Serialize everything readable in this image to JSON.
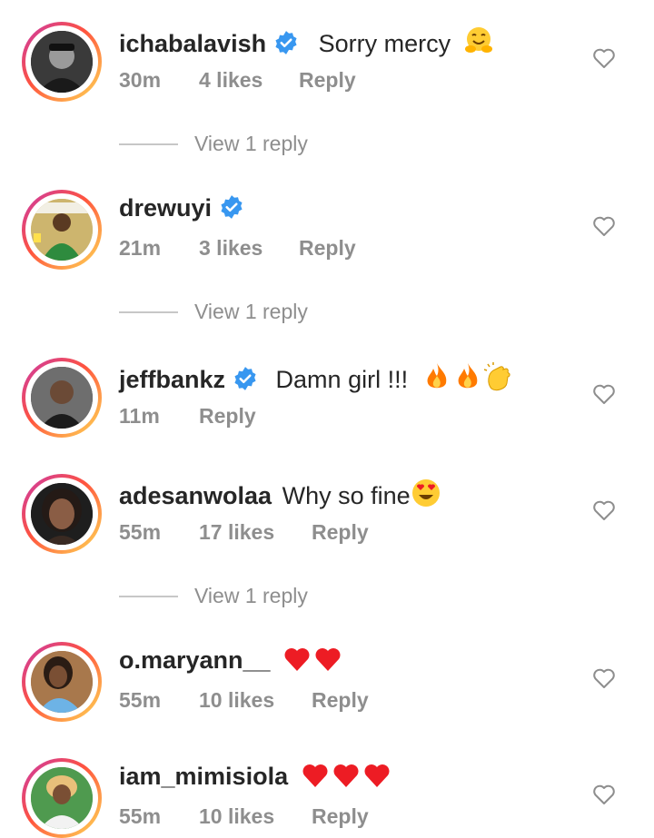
{
  "comments": [
    {
      "username": "ichabalavish",
      "verified": true,
      "text": "Sorry mercy",
      "emojis": [
        "hug"
      ],
      "time": "30m",
      "likes": "4 likes",
      "reply": "Reply",
      "view_replies": "View 1 reply"
    },
    {
      "username": "drewuyi",
      "verified": true,
      "text": "",
      "emojis": [],
      "time": "21m",
      "likes": "3 likes",
      "reply": "Reply",
      "view_replies": "View 1 reply"
    },
    {
      "username": "jeffbankz",
      "verified": true,
      "text": "Damn girl !!!",
      "emojis": [
        "fire",
        "fire",
        "clap"
      ],
      "time": "11m",
      "likes": "",
      "reply": "Reply",
      "view_replies": ""
    },
    {
      "username": "adesanwolaa",
      "verified": false,
      "text": "Why so fine",
      "emojis": [
        "heart-eyes"
      ],
      "time": "55m",
      "likes": "17 likes",
      "reply": "Reply",
      "view_replies": "View 1 reply"
    },
    {
      "username": "o.maryann__",
      "verified": false,
      "text": "",
      "emojis": [
        "red-heart",
        "red-heart"
      ],
      "time": "55m",
      "likes": "10 likes",
      "reply": "Reply",
      "view_replies": ""
    },
    {
      "username": "iam_mimisiola",
      "verified": false,
      "text": "",
      "emojis": [
        "red-heart",
        "red-heart",
        "red-heart"
      ],
      "time": "55m",
      "likes": "10 likes",
      "reply": "Reply",
      "view_replies": ""
    }
  ],
  "colors": {
    "verified": "#3897f0",
    "muted": "#8e8e8e",
    "heart": "#ed1c24",
    "fire": "#ff7a00",
    "emoji_yellow": "#ffcc33"
  }
}
